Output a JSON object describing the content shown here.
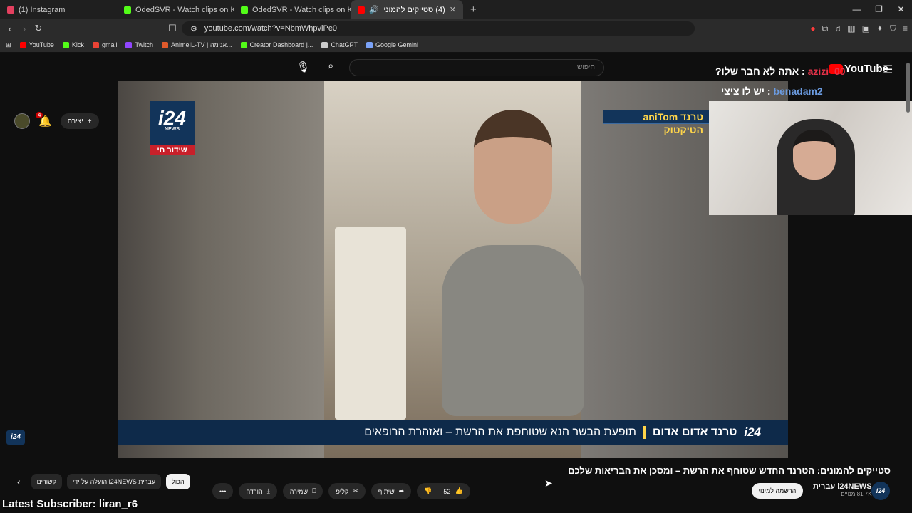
{
  "tabs": [
    {
      "title": "(1) Instagram",
      "color": "#e4405f"
    },
    {
      "title": "OdedSVR - Watch clips on Kick",
      "color": "#53fc18"
    },
    {
      "title": "OdedSVR - Watch clips on Kick",
      "color": "#53fc18"
    },
    {
      "title": "(4) סטייקים להמונים: הטרנד",
      "color": "#ff0000"
    }
  ],
  "address": {
    "url": "youtube.com/watch?v=NbmWhpvlPe0"
  },
  "bookmarks": [
    {
      "label": "YouTube",
      "color": "#ff0000"
    },
    {
      "label": "Kick",
      "color": "#53fc18"
    },
    {
      "label": "gmail",
      "color": "#ea4335"
    },
    {
      "label": "Twitch",
      "color": "#9146ff"
    },
    {
      "label": "AnimeIL-TV | אנימה...",
      "color": "#e05a2b"
    },
    {
      "label": "Creator Dashboard |...",
      "color": "#53fc18"
    },
    {
      "label": "ChatGPT",
      "color": "#cccccc"
    },
    {
      "label": "Google Gemini",
      "color": "#7aa2f7"
    }
  ],
  "yt": {
    "logo": "YouTube",
    "search_placeholder": "חיפוש",
    "create_label": "יצירה",
    "notif_count": "4"
  },
  "video": {
    "logo_text": "i24",
    "logo_sub": "NEWS",
    "live_label": "שידור חי",
    "tiktok_tag": "aniTom טרנד הטיקטוק",
    "ticker_headline": "טרנד אדום אדום",
    "ticker_text": "תופעת הבשר הנא שטוחפת את הרשת – ואזהרת הרופאים",
    "ticker_brand": "i24"
  },
  "stream": {
    "chat": [
      {
        "name": "azizi_00",
        "msg": "אתה לא חבר שלו?"
      },
      {
        "name": "benadam2",
        "msg": "יש לו ציצי"
      }
    ],
    "latest_sub": "Latest Subscriber: liran_r6"
  },
  "meta": {
    "title": "סטייקים להמונים: הטרנד החדש שטוחף את הרשת – ומסכן את הבריאות שלכם",
    "channel": "i24NEWS עברית",
    "subs": "81.7K מנויים",
    "subscribe": "הרשמה למינוי",
    "likes": "52",
    "share": "שיתוף",
    "clip": "קליפ",
    "save": "שמירה",
    "download": "הורדה"
  },
  "chips": [
    "הכול",
    "הועלה על ידי i24NEWS עברית",
    "קשורים"
  ]
}
